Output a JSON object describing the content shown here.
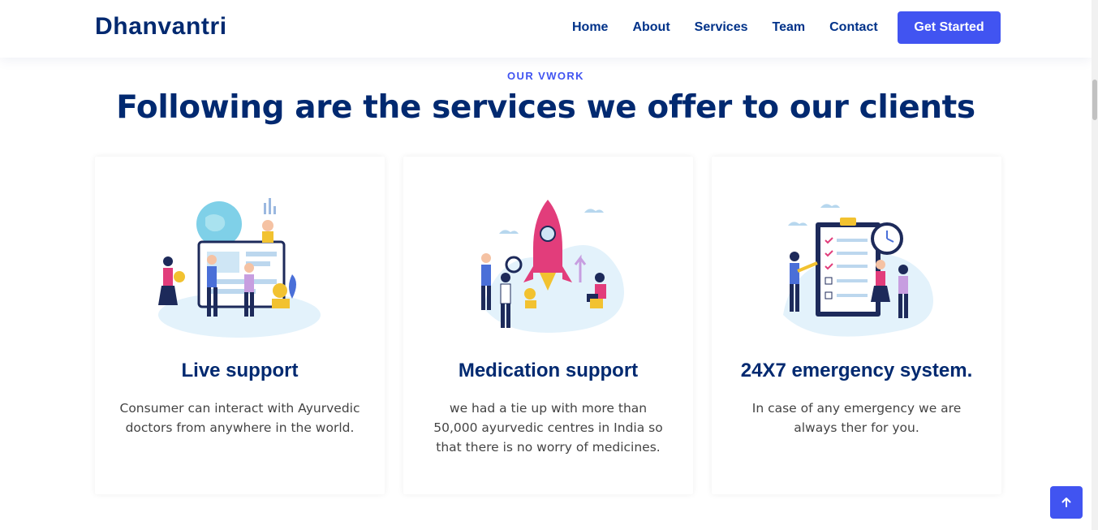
{
  "header": {
    "logo": "Dhanvantri",
    "nav": [
      "Home",
      "About",
      "Services",
      "Team",
      "Contact"
    ],
    "cta": "Get Started"
  },
  "section": {
    "eyebrow": "OUR VWORK",
    "title": "Following are the services we offer to our clients"
  },
  "cards": [
    {
      "title": "Live support",
      "text": "Consumer can interact with Ayurvedic doctors from anywhere in the world."
    },
    {
      "title": "Medication support",
      "text": "we had a tie up with more than 50,000 ayurvedic centres in India so that there is no worry of medicines."
    },
    {
      "title": "24X7 emergency system.",
      "text": "In case of any emergency we are always ther for you."
    }
  ],
  "colors": {
    "primary": "#4154f1",
    "heading": "#012970",
    "nav": "#013289",
    "body_text": "#444444"
  },
  "icons": {
    "back_to_top": "arrow-up-icon"
  }
}
